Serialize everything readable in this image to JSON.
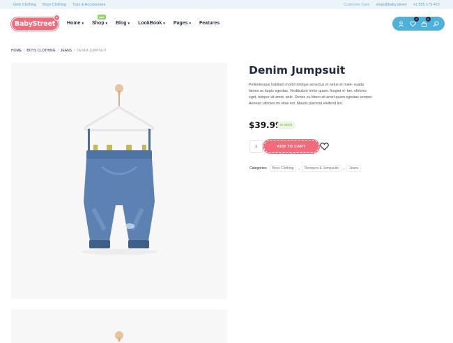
{
  "topbar": {
    "links": [
      "Girls Clothing",
      "Boys Clothing",
      "Toys & Accessories"
    ],
    "care_label": "Customer Care",
    "email": "shop@baby.street",
    "phone": "+1 555 179 472"
  },
  "header": {
    "logo_text": "BabyStreet",
    "nav": [
      {
        "label": "Home"
      },
      {
        "label": "Shop",
        "badge": "sale"
      },
      {
        "label": "Blog"
      },
      {
        "label": "LookBook"
      },
      {
        "label": "Pages"
      },
      {
        "label": "Features"
      }
    ],
    "icons": [
      "user-icon",
      "heart-icon",
      "bag-icon",
      "search-icon"
    ],
    "wishlist_count": "0",
    "cart_count": "0"
  },
  "breadcrumb": [
    "HOME",
    "BOYS CLOTHING",
    "JEANS",
    "DENIM JUMPSUIT"
  ],
  "product": {
    "title": "Denim Jumpsuit",
    "description": "Pellentesque habitant morbi tristique senectus et netus et male- suada fames ac turpis egestas. Vestibulum tortor quam, feugiat vi- tae, ultricies eget, tempor sit amet, ante. Donec eu libero sit amet quam egestas semper. Aenean ultricies mi vitae est. Mauris placerat eleifend leo.",
    "price": "$39.99",
    "stock": "In stock",
    "quantity": "1",
    "add_to_cart": "ADD TO CART",
    "categories_label": "Categories:",
    "categories": [
      "Boys Clothing",
      "Rompers & Jumpsuits",
      "Jeans"
    ]
  },
  "colors": {
    "accent": "#f26b7a",
    "icon_bar": "#4eb1dc",
    "topbar_bg": "#eaf4f9"
  }
}
